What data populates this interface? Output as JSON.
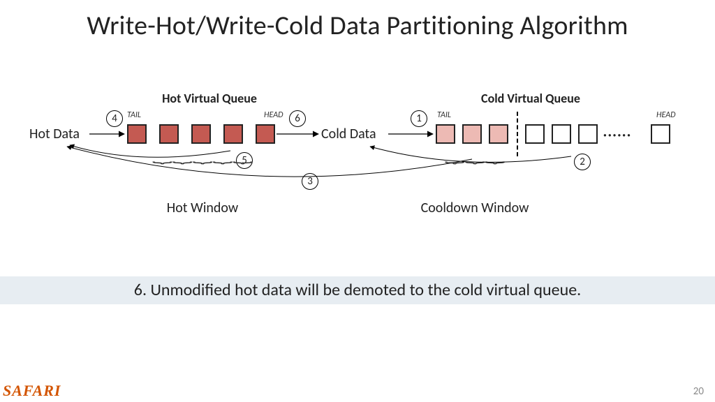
{
  "title": "Write-Hot/Write-Cold Data Partitioning Algorithm",
  "callout": "6. Unmodified hot data will be demoted to the cold virtual queue.",
  "brand": "SAFARI",
  "page": "20",
  "diagram": {
    "hot_queue_label": "Hot Virtual Queue",
    "cold_queue_label": "Cold Virtual Queue",
    "hot_data_label": "Hot Data",
    "cold_data_label": "Cold Data",
    "tail": "TAIL",
    "head": "HEAD",
    "hot_window": "Hot Window",
    "cooldown_window": "Cooldown Window",
    "steps": {
      "s1": "1",
      "s2": "2",
      "s3": "3",
      "s4": "4",
      "s5": "5",
      "s6": "6"
    },
    "ellipsis": "······"
  }
}
